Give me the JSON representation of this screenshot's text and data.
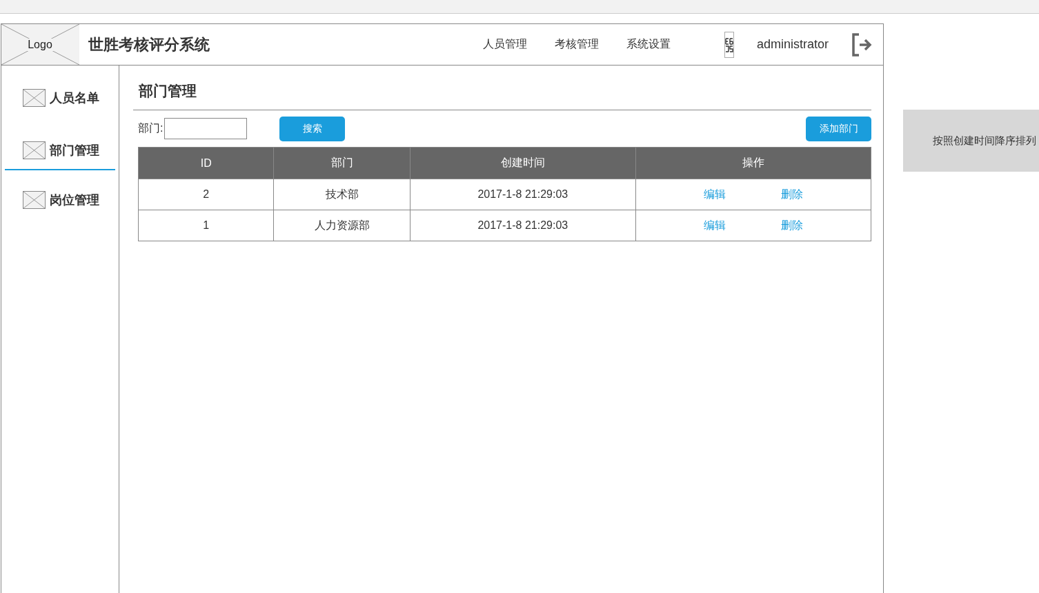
{
  "header": {
    "logo": "Logo",
    "title": "世胜考核评分系统",
    "nav": [
      {
        "label": "人员管理"
      },
      {
        "label": "考核管理"
      },
      {
        "label": "系统设置"
      }
    ],
    "user": "administrator"
  },
  "sidebar": {
    "items": [
      {
        "label": "人员名单",
        "selected": false
      },
      {
        "label": "部门管理",
        "selected": true
      },
      {
        "label": "岗位管理",
        "selected": false
      }
    ]
  },
  "page": {
    "title": "部门管理",
    "filter_label": "部门:",
    "search_button": "搜索",
    "add_button": "添加部门"
  },
  "table": {
    "columns": [
      "ID",
      "部门",
      "创建时间",
      "操作"
    ],
    "rows": [
      {
        "id": "2",
        "department": "技术部",
        "created": "2017-1-8 21:29:03",
        "actions": [
          "编辑",
          "删除"
        ]
      },
      {
        "id": "1",
        "department": "人力资源部",
        "created": "2017-1-8 21:29:03",
        "actions": [
          "编辑",
          "删除"
        ]
      }
    ]
  },
  "note": "按照创建时间降序排列"
}
